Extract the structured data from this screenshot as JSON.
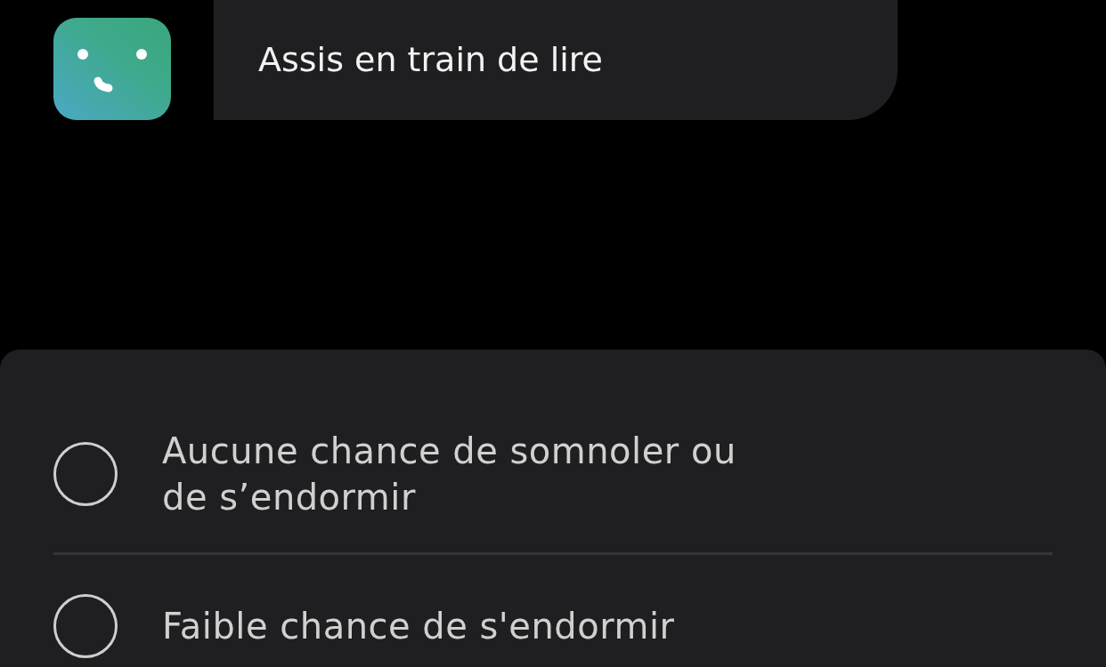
{
  "message": {
    "text": "Assis en train de lire"
  },
  "options": [
    {
      "label": "Aucune chance de somnoler ou de s’endormir",
      "selected": false
    },
    {
      "label": "Faible chance de s'endormir",
      "selected": false
    }
  ]
}
